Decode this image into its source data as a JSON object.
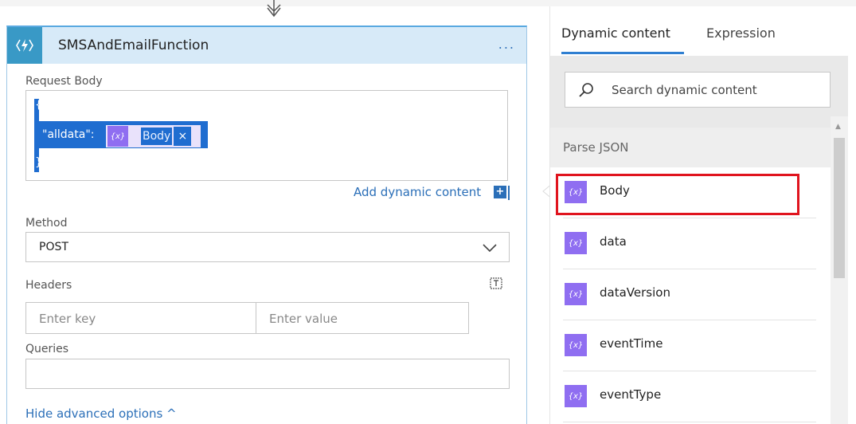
{
  "card": {
    "title": "SMSAndEmailFunction",
    "more": "...",
    "request_body": {
      "label": "Request Body",
      "line_open": "{",
      "key": "\"alldata\":",
      "token_icon": "{x}",
      "token_label": "Body",
      "token_close": "×",
      "line_close": "}"
    },
    "add_dynamic_content": "Add dynamic content",
    "add_dynamic_icon": "+",
    "method": {
      "label": "Method",
      "value": "POST"
    },
    "headers": {
      "label": "Headers",
      "key_placeholder": "Enter key",
      "value_placeholder": "Enter value"
    },
    "queries": {
      "label": "Queries"
    },
    "hide_advanced": "Hide advanced options ^"
  },
  "panel": {
    "tabs": [
      {
        "label": "Dynamic content",
        "active": true
      },
      {
        "label": "Expression",
        "active": false
      }
    ],
    "search_placeholder": "Search dynamic content",
    "group": "Parse JSON",
    "items": [
      {
        "label": "Body",
        "icon": "{x}",
        "highlighted": true
      },
      {
        "label": "data",
        "icon": "{x}"
      },
      {
        "label": "dataVersion",
        "icon": "{x}"
      },
      {
        "label": "eventTime",
        "icon": "{x}"
      },
      {
        "label": "eventType",
        "icon": "{x}"
      }
    ]
  },
  "colors": {
    "accent": "#2f7fd1",
    "token_purple": "#8f6ef1",
    "selection_blue": "#1f6dd0",
    "highlight_red": "#e0141e",
    "header_bg": "#d7eaf8"
  },
  "icons": [
    "lightning-function-icon",
    "more-ellipsis-icon",
    "chevron-down-icon",
    "headers-text-mode-icon",
    "search-icon",
    "dynamic-content-token-icon",
    "connector-arrow-icon"
  ]
}
